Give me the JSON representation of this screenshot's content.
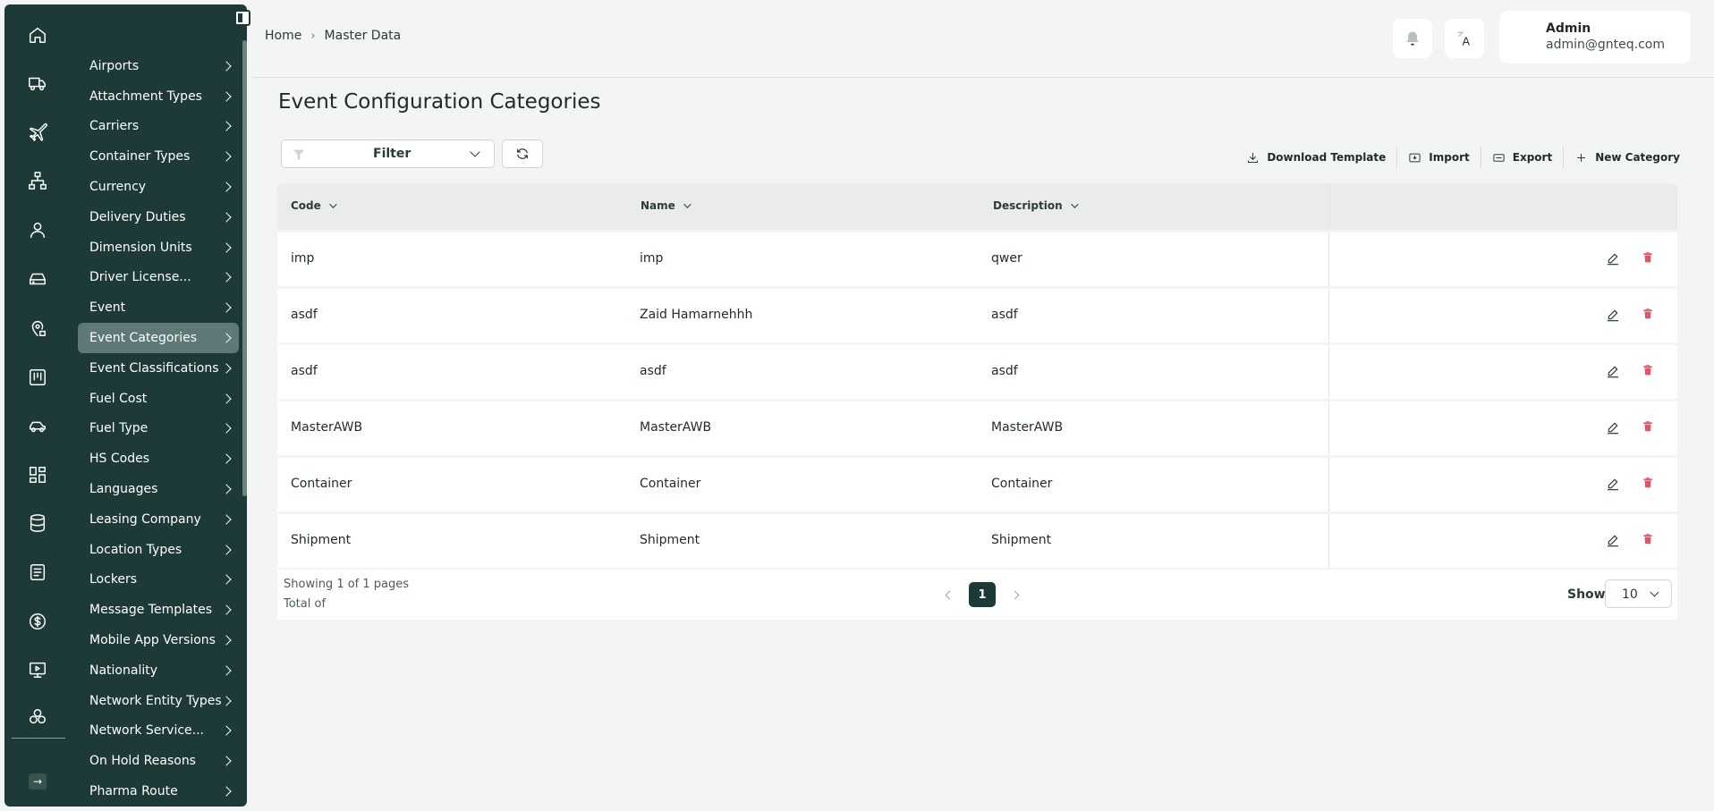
{
  "breadcrumb": {
    "home": "Home",
    "separator": "›",
    "current": "Master Data"
  },
  "user": {
    "name": "Admin",
    "email": "admin@gnteq.com"
  },
  "rail_icons": [
    "home-icon",
    "truck-icon",
    "plane-icon",
    "hierarchy-icon",
    "user-icon",
    "drive-icon",
    "location-icon",
    "board-icon",
    "car-icon",
    "grid-icon",
    "database-icon",
    "document-icon",
    "dollar-icon",
    "monitor-icon",
    "modules-icon"
  ],
  "sidebar": {
    "items": [
      {
        "label": "Airports"
      },
      {
        "label": "Attachment Types"
      },
      {
        "label": "Carriers"
      },
      {
        "label": "Container Types"
      },
      {
        "label": "Currency"
      },
      {
        "label": "Delivery Duties"
      },
      {
        "label": "Dimension Units"
      },
      {
        "label": "Driver License..."
      },
      {
        "label": "Event"
      },
      {
        "label": "Event Categories"
      },
      {
        "label": "Event Classifications"
      },
      {
        "label": "Fuel Cost"
      },
      {
        "label": "Fuel Type"
      },
      {
        "label": "HS Codes"
      },
      {
        "label": "Languages"
      },
      {
        "label": "Leasing Company"
      },
      {
        "label": "Location Types"
      },
      {
        "label": "Lockers"
      },
      {
        "label": "Message Templates"
      },
      {
        "label": "Mobile App Versions"
      },
      {
        "label": "Nationality"
      },
      {
        "label": "Network Entity Types"
      },
      {
        "label": "Network Service..."
      },
      {
        "label": "On Hold Reasons"
      },
      {
        "label": "Pharma Route"
      }
    ],
    "active": "Event Categories"
  },
  "page": {
    "title": "Event Configuration Categories"
  },
  "toolbar": {
    "filter_label": "Filter",
    "download_template": "Download Template",
    "import": "Import",
    "export": "Export",
    "new_category": "New Category"
  },
  "table": {
    "headers": {
      "code": "Code",
      "name": "Name",
      "description": "Description"
    },
    "rows": [
      {
        "code": "imp",
        "name": "imp",
        "description": "qwer"
      },
      {
        "code": "asdf",
        "name": "Zaid Hamarnehhh",
        "description": "asdf"
      },
      {
        "code": "asdf",
        "name": "asdf",
        "description": "asdf"
      },
      {
        "code": "MasterAWB",
        "name": "MasterAWB",
        "description": "MasterAWB"
      },
      {
        "code": "Container",
        "name": "Container",
        "description": "Container"
      },
      {
        "code": "Shipment",
        "name": "Shipment",
        "description": "Shipment"
      }
    ]
  },
  "footer": {
    "showing": "Showing 1 of 1 pages",
    "total": "Total of",
    "current_page": "1",
    "show_label": "Show",
    "page_size": "10"
  },
  "colors": {
    "sidebar": "#1d3a39",
    "active_item": "#5f7978",
    "delete": "#e0556a",
    "background": "#f3f4f4"
  }
}
